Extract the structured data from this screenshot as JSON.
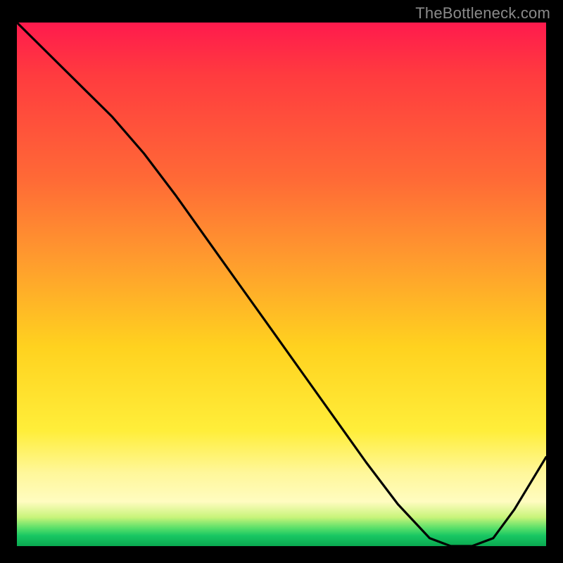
{
  "attribution": "TheBottleneck.com",
  "baseline_marker_text": "",
  "colors": {
    "background": "#000000",
    "gradient_top": "#ff1a4d",
    "gradient_mid1": "#ff9a2e",
    "gradient_mid2": "#ffee3a",
    "gradient_bottom": "#0aa850",
    "curve": "#000000",
    "attribution_text": "#8a8a8a",
    "marker_text": "#d43a2a"
  },
  "chart_data": {
    "type": "line",
    "title": "",
    "xlabel": "",
    "ylabel": "",
    "xlim": [
      0,
      100
    ],
    "ylim": [
      0,
      100
    ],
    "series": [
      {
        "name": "bottleneck-curve",
        "x": [
          0,
          6,
          12,
          18,
          24,
          30,
          36,
          42,
          48,
          54,
          60,
          66,
          72,
          78,
          82,
          86,
          90,
          94,
          100
        ],
        "values": [
          100,
          94,
          88,
          82,
          75,
          67,
          58.5,
          50,
          41.5,
          33,
          24.5,
          16,
          8,
          1.5,
          0,
          0,
          1.5,
          7,
          17
        ]
      }
    ],
    "annotations": [
      {
        "type": "baseline-marker",
        "x_range": [
          78,
          90
        ],
        "y": 0
      }
    ]
  }
}
